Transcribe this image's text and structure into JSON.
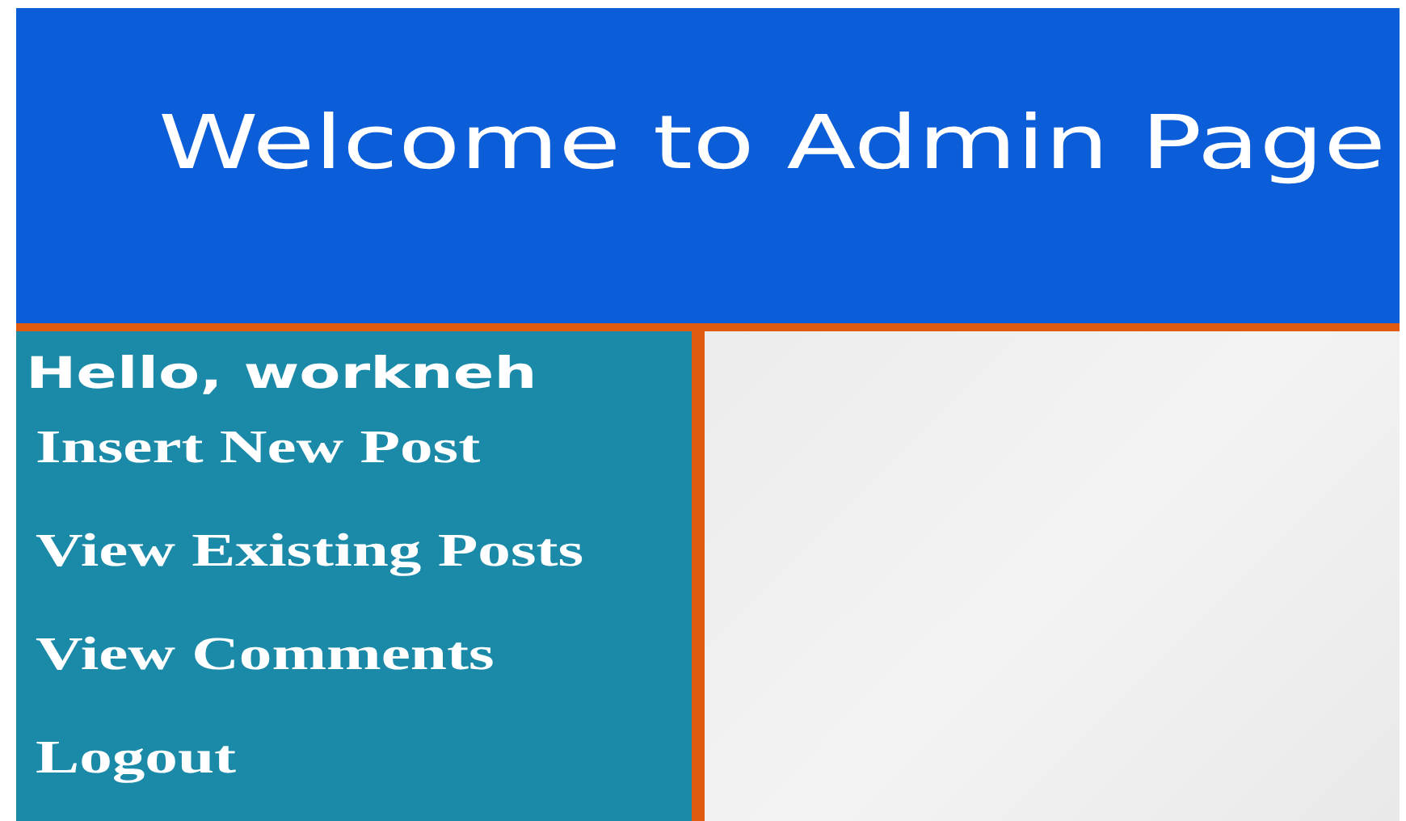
{
  "header": {
    "title": "Welcome to Admin Page"
  },
  "sidebar": {
    "greeting": "Hello, workneh",
    "links": [
      {
        "label": "Insert New Post"
      },
      {
        "label": "View Existing Posts"
      },
      {
        "label": "View Comments"
      },
      {
        "label": "Logout"
      }
    ]
  }
}
